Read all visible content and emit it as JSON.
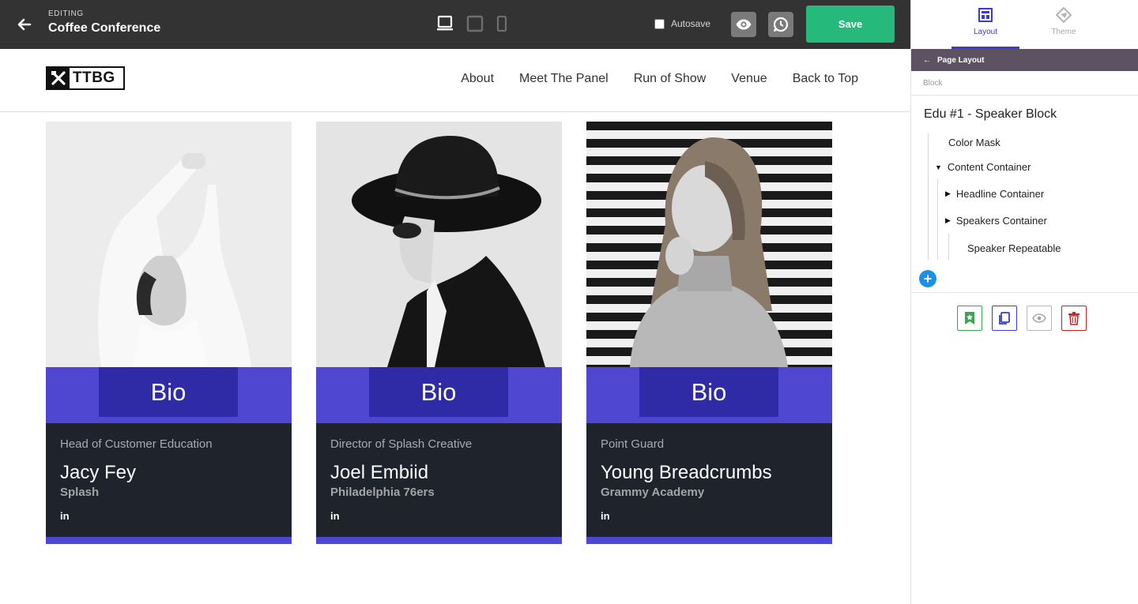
{
  "topbar": {
    "editing_label": "EDITING",
    "title": "Coffee Conference",
    "autosave_label": "Autosave",
    "save_label": "Save"
  },
  "site": {
    "logo_text": "TTBG",
    "nav": [
      "About",
      "Meet The Panel",
      "Run of Show",
      "Venue",
      "Back to Top"
    ]
  },
  "cards": [
    {
      "bio_label": "Bio",
      "role": "Head of Customer Education",
      "name": "Jacy Fey",
      "org": "Splash",
      "social": "in"
    },
    {
      "bio_label": "Bio",
      "role": "Director of Splash Creative",
      "name": "Joel Embiid",
      "org": "Philadelphia 76ers",
      "social": "in"
    },
    {
      "bio_label": "Bio",
      "role": "Point Guard",
      "name": "Young Breadcrumbs",
      "org": "Grammy Academy",
      "social": "in"
    }
  ],
  "panel": {
    "tabs": {
      "layout": "Layout",
      "theme": "Theme"
    },
    "page_layout": "Page Layout",
    "block_label": "Block",
    "tree": {
      "title": "Edu #1 - Speaker Block",
      "color_mask": "Color Mask",
      "content_container": "Content Container",
      "headline_container": "Headline Container",
      "speakers_container": "Speakers Container",
      "speaker_repeatable": "Speaker Repeatable"
    }
  },
  "colors": {
    "accent_purple": "#4f47d1",
    "bio_button": "#2f2aa6",
    "card_dark": "#1f232b",
    "save_green": "#26b97c",
    "topbar": "#333333",
    "panel_active": "#3a3ccd"
  }
}
